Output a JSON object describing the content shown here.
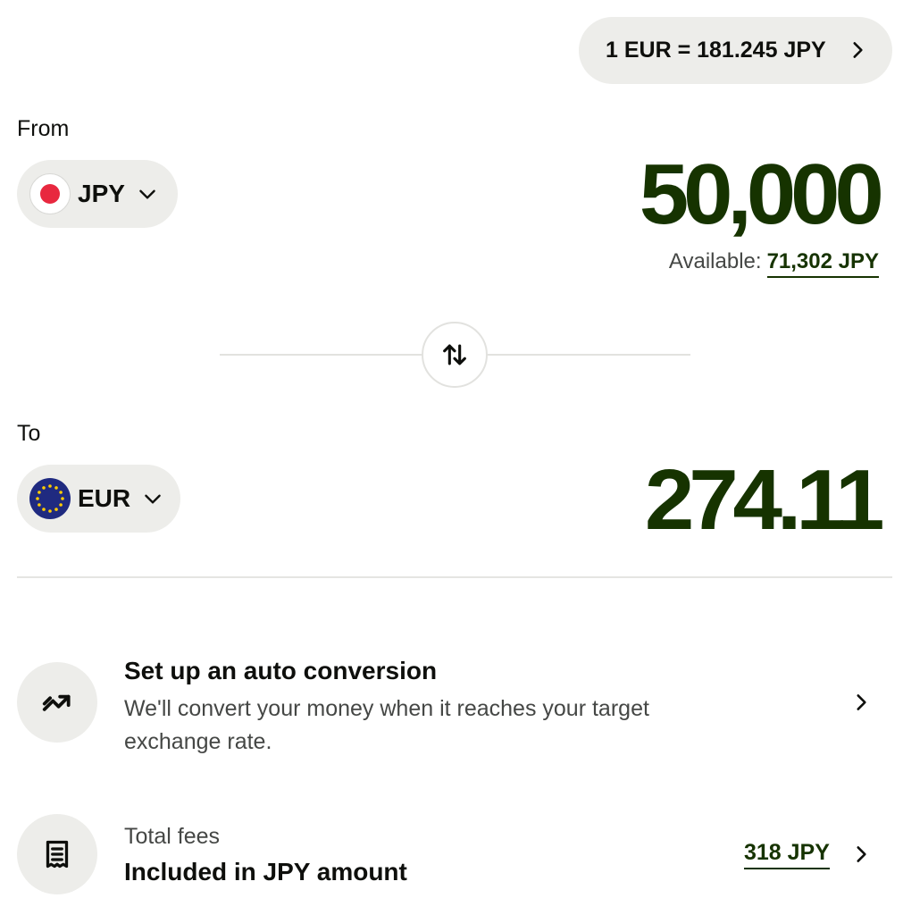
{
  "rate": {
    "text": "1 EUR = 181.245 JPY"
  },
  "from": {
    "label": "From",
    "currency": "JPY",
    "amount": "50,000",
    "available_label": "Available:",
    "available_value": "71,302 JPY"
  },
  "to": {
    "label": "To",
    "currency": "EUR",
    "amount": "274.11"
  },
  "auto_conversion": {
    "title": "Set up an auto conversion",
    "description": "We'll convert your money when it reaches your target exchange rate."
  },
  "fees": {
    "label": "Total fees",
    "title": "Included in JPY amount",
    "value": "318 JPY"
  },
  "colors": {
    "accent_dark_green": "#163300",
    "pill_bg": "#ededea",
    "jp_red": "#e8283f",
    "eu_blue": "#1f2a80",
    "eu_star": "#ffcc00"
  },
  "icons": {
    "rate_chevron": "chevron-right-icon",
    "currency_dropdown": "chevron-down-icon",
    "swap": "swap-vertical-icon",
    "auto_conversion": "trending-up-icon",
    "fees": "receipt-icon"
  }
}
